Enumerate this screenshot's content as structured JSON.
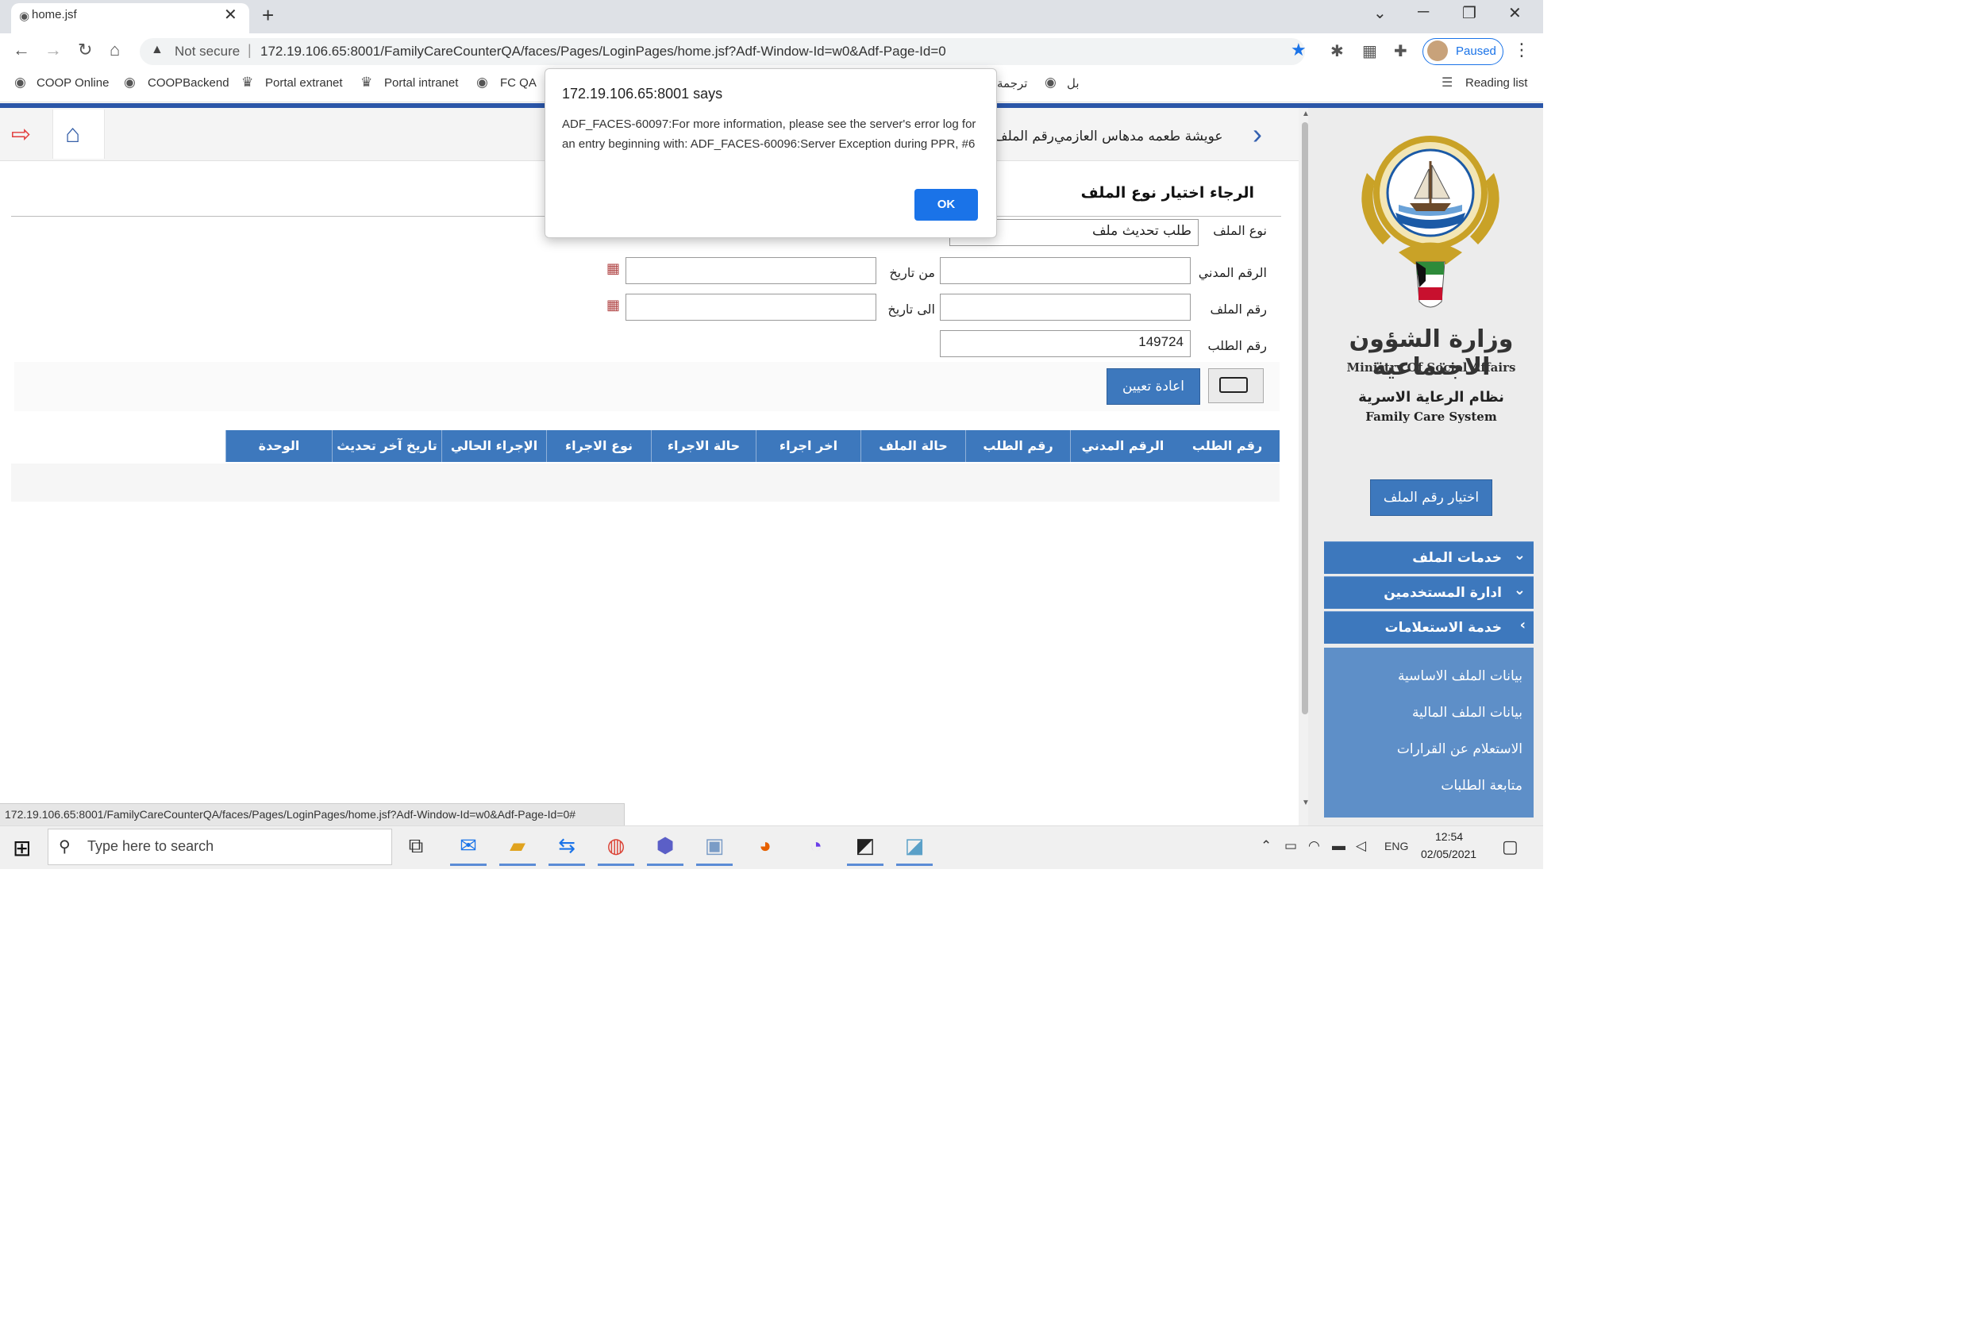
{
  "browser": {
    "tab_title": "home.jsf",
    "tab_close": "✕",
    "new_tab": "+",
    "not_secure": "Not secure",
    "url": "172.19.106.65:8001/FamilyCareCounterQA/faces/Pages/LoginPages/home.jsf?Adf-Window-Id=w0&Adf-Page-Id=0",
    "profile_status": "Paused",
    "bookmarks": [
      "COOP Online",
      "COOPBackend",
      "Portal extranet",
      "Portal intranet",
      "FC QA"
    ],
    "bookmarks_rtl": [
      "ترجمة",
      "بل"
    ],
    "reading_list": "Reading list"
  },
  "header": {
    "user_name": "عويشة طعمه مدهاس العازمي",
    "file_no_label": "رقم الملف"
  },
  "sidebar": {
    "ministry_ar": "وزارة الشؤون الاجتماعية",
    "ministry_en": "Ministry Of Social Affairs",
    "system_ar": "نظام الرعاية الاسرية",
    "system_en": "Family Care System",
    "choose_file_button": "اختيار رقم الملف",
    "menu": [
      {
        "label": "خدمات الملف",
        "chevron": "⌄"
      },
      {
        "label": "ادارة المستخدمين",
        "chevron": "⌄"
      },
      {
        "label": "خدمة الاستعلامات",
        "chevron": "‹"
      }
    ],
    "submenu": [
      "بيانات الملف الاساسية",
      "بيانات الملف المالية",
      "الاستعلام عن القرارات",
      "متابعة الطلبات"
    ]
  },
  "form": {
    "title": "الرجاء اختيار نوع الملف",
    "file_type_label": "نوع الملف",
    "file_type_value": "طلب تحديث ملف",
    "civil_id_label": "الرقم المدني",
    "civil_id_value": "",
    "file_no_label": "رقم الملف",
    "file_no_value": "",
    "request_no_label": "رقم الطلب",
    "request_no_value": "149724",
    "from_date_label": "من تاريخ",
    "to_date_label": "الى تاريخ",
    "reset_button": "اعادة تعيين"
  },
  "table": {
    "columns": [
      "رقم الطلب",
      "الرقم المدني",
      "رقم الطلب",
      "حالة الملف",
      "اخر اجراء",
      "حالة الاجراء",
      "نوع الاجراء",
      "الإجراء الحالي",
      "تاريخ آخر تحديث",
      "الوحدة"
    ]
  },
  "dialog": {
    "title": "172.19.106.65:8001 says",
    "message": "ADF_FACES-60097:For more information, please see the server's error log for an entry beginning with: ADF_FACES-60096:Server Exception during PPR, #6",
    "ok": "OK"
  },
  "status_bar": "172.19.106.65:8001/FamilyCareCounterQA/faces/Pages/LoginPages/home.jsf?Adf-Window-Id=w0&Adf-Page-Id=0#",
  "taskbar": {
    "search_placeholder": "Type here to search",
    "language": "ENG",
    "time": "12:54",
    "date": "02/05/2021"
  }
}
